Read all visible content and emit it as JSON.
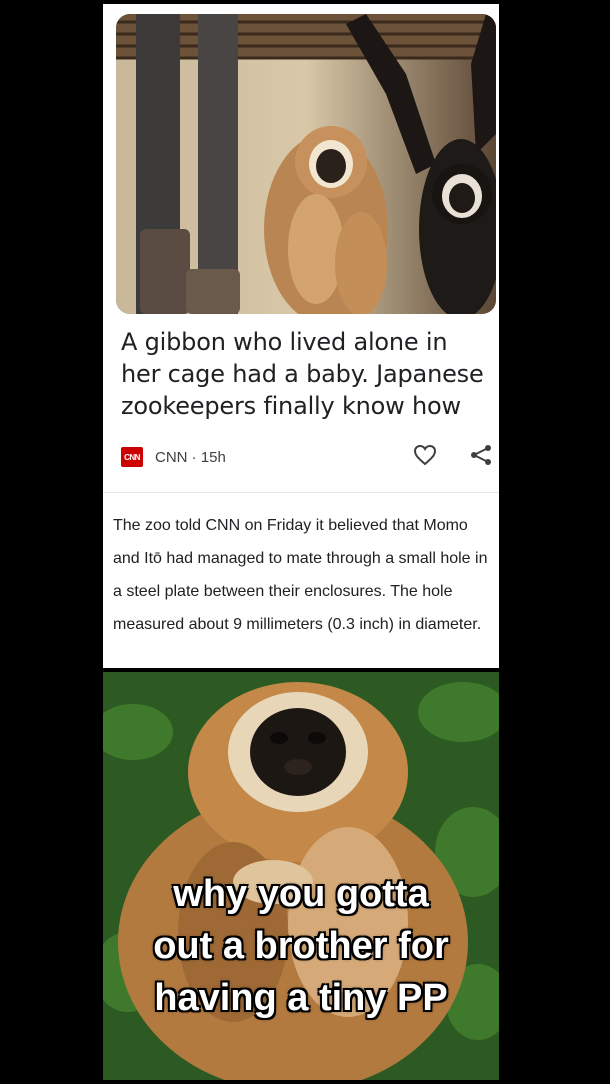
{
  "article": {
    "headline": "A gibbon who lived alone in her cage had a baby. Japanese zookeepers finally know how",
    "source_logo_text": "CNN",
    "source": "CNN · 15h",
    "excerpt": "The zoo told CNN on Friday it believed that Momo and Itō had managed to mate through a small hole in a steel plate between their enclosures. The hole measured about 9 millimeters (0.3 inch) in diameter.",
    "icons": [
      "heart-icon",
      "share-icon"
    ],
    "brand_color": "#cc0000"
  },
  "meme": {
    "caption_lines": [
      "why you gotta",
      "out a brother for",
      "having a tiny PP"
    ]
  }
}
